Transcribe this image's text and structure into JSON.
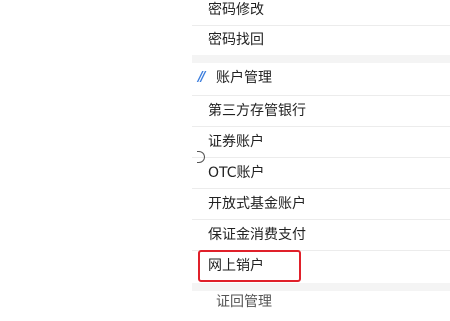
{
  "menu": {
    "top_items": [
      {
        "label": "密码修改"
      },
      {
        "label": "密码找回"
      }
    ],
    "section": {
      "title": "账户管理",
      "marker": "//",
      "items": [
        {
          "label": "第三方存管银行"
        },
        {
          "label": "证券账户"
        },
        {
          "label": "OTC账户"
        },
        {
          "label": "开放式基金账户"
        },
        {
          "label": "保证金消费支付"
        },
        {
          "label": "网上销户",
          "highlighted": true
        }
      ]
    },
    "next_section_title": "证回管理"
  },
  "colors": {
    "accent": "#3b7ddd",
    "highlight": "#e0202a",
    "divider": "#ececec"
  }
}
